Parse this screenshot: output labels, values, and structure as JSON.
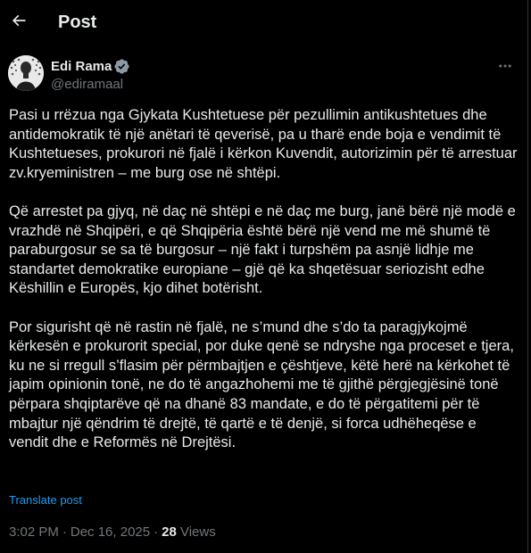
{
  "header": {
    "title": "Post",
    "back_icon": "arrow-left-icon"
  },
  "author": {
    "name": "Edi Rama",
    "handle": "@ediramaal",
    "verified": true,
    "verified_color": "#8b98a5",
    "avatar_icon": "profile-photo"
  },
  "post": {
    "paragraphs": [
      "Pasi u rrëzua nga Gjykata Kushtetuese për pezullimin antikushtetues dhe antidemokratik të një anëtari të qeverisë, pa u tharë ende boja e vendimit të Kushtetueses, prokurori në fjalë i kërkon Kuvendit, autorizimin për të arrestuar zv.kryeministren – me burg ose në shtëpi.",
      "Që arrestet pa gjyq, në daç në shtëpi e në daç me burg, janë bërë një modë e vrazhdë në Shqipëri, e që Shqipëria është bërë një vend me më shumë të paraburgosur se sa të burgosur – një fakt i turpshëm pa asnjë lidhje me standartet demokratike europiane – gjë që ka shqetësuar seriozisht edhe Këshillin e Europës, kjo dihet botërisht.",
      "Por sigurisht që në rastin në fjalë, ne s’mund dhe s’do ta paragjykojmë kërkesën e prokurorit special, por duke qenë se ndryshe nga proceset e tjera, ku ne si rregull s’flasim për përmbajtjen e çështjeve, këtë herë na kërkohet të japim opinionin tonë, ne do të angazhohemi me të gjithë përgjegjësinë tonë përpara shqiptarëve që na dhanë 83 mandate, e do të përgatitemi për të mbajtur një qëndrim të drejtë, të qartë e të denjë, si forca udhëheqëse e vendit dhe e Reformës në Drejtësi."
    ],
    "translate_label": "Translate post",
    "time": "3:02 PM",
    "separator": "·",
    "date": "Dec 16, 2025",
    "views_count": "28",
    "views_label": "Views",
    "more_icon": "more-horizontal-icon"
  },
  "colors": {
    "background": "#000000",
    "text": "#e7e9ea",
    "secondary": "#71767b",
    "link": "#1d9bf0",
    "border": "#2f3336"
  }
}
